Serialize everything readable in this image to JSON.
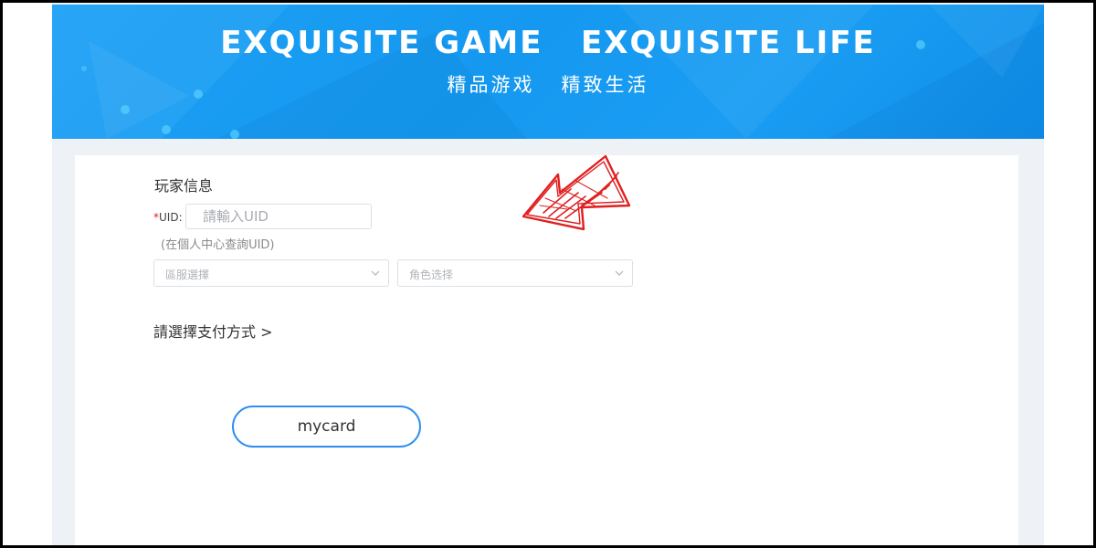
{
  "banner": {
    "title": "EXQUISITE GAME   EXQUISITE LIFE",
    "subtitle": "精品游戏   精致生活"
  },
  "form": {
    "section_title": "玩家信息",
    "uid": {
      "required_mark": "*",
      "label": "UID:",
      "placeholder": "請輸入UID",
      "value": "",
      "hint": "(在個人中心查詢UID)"
    },
    "server_select": {
      "placeholder": "區服選擇",
      "icon": "chevron-down-icon"
    },
    "role_select": {
      "placeholder": "角色选择",
      "icon": "chevron-down-icon"
    }
  },
  "payment": {
    "title": "請選擇支付方式 >",
    "methods": [
      {
        "label": "mycard"
      }
    ]
  },
  "annotation": {
    "icon": "red-hand-drawn-arrow-icon",
    "color": "#e02020"
  },
  "colors": {
    "banner_blue": "#1da1f6",
    "page_bg": "#eef2f6",
    "button_border": "#2f8ff0",
    "required": "#e02020"
  }
}
